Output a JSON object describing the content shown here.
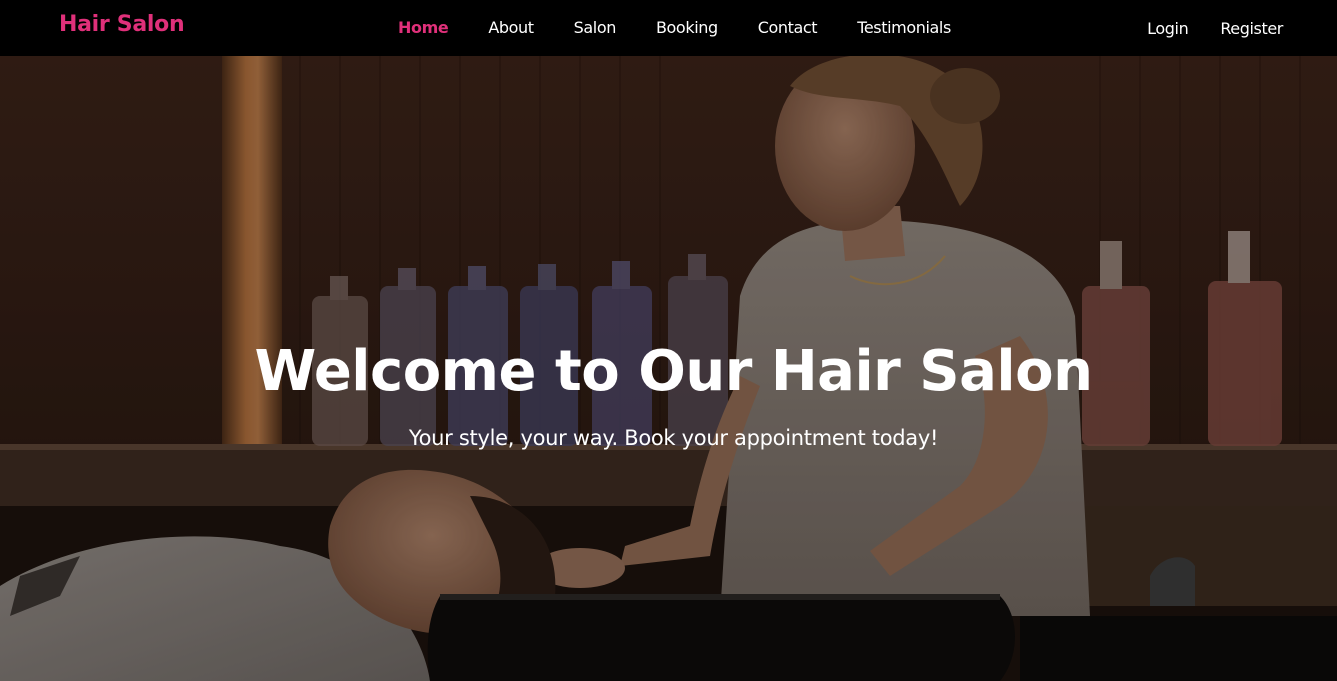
{
  "nav": {
    "brand": "Hair Salon",
    "links": [
      {
        "label": "Home",
        "active": true
      },
      {
        "label": "About"
      },
      {
        "label": "Salon"
      },
      {
        "label": "Booking"
      },
      {
        "label": "Contact"
      },
      {
        "label": "Testimonials"
      }
    ],
    "auth": {
      "login": "Login",
      "register": "Register"
    }
  },
  "hero": {
    "title": "Welcome to Our Hair Salon",
    "subtitle": "Your style, your way. Book your appointment today!",
    "image": "salon-hair-washing-photo"
  },
  "colors": {
    "accent": "#e0307a",
    "nav_bg": "#000000",
    "text": "#ffffff"
  }
}
